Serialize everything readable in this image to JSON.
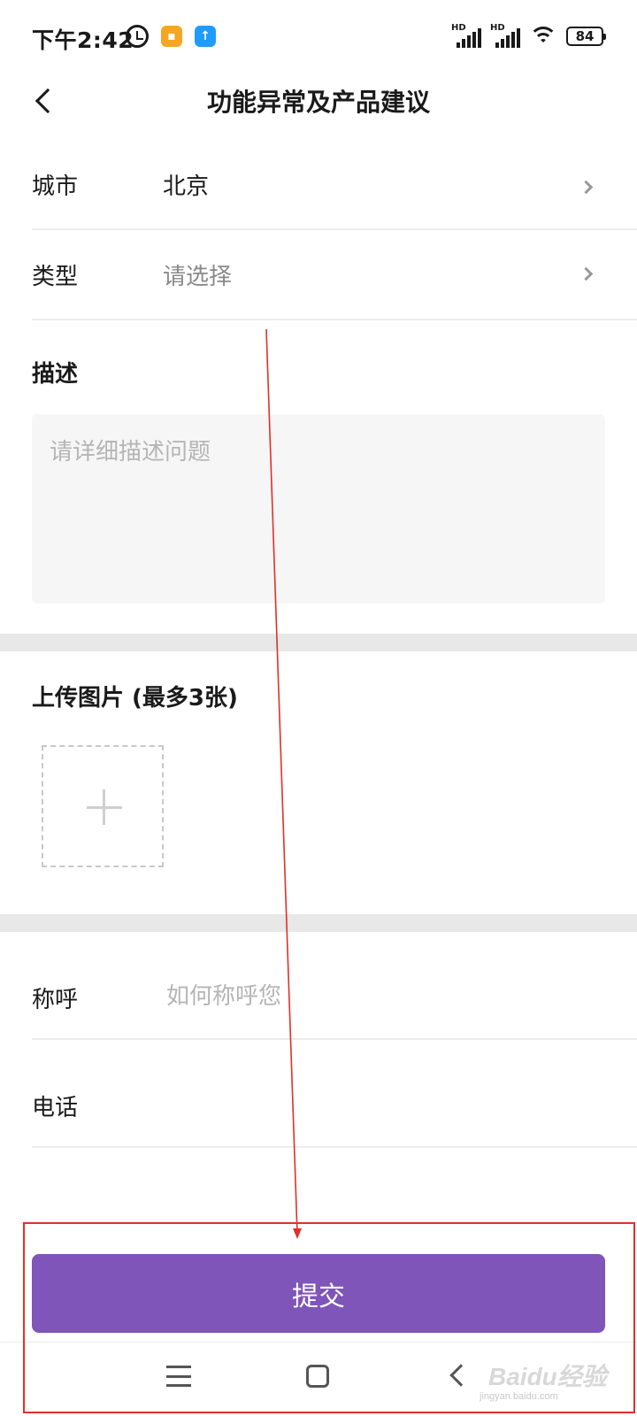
{
  "status_bar": {
    "time": "下午2:42",
    "left_icons": [
      "alarm-clock-icon",
      "notes-app-icon",
      "upload-app-icon"
    ],
    "network_label": "HD",
    "battery": "84"
  },
  "header": {
    "title": "功能异常及产品建议",
    "back_icon": "chevron-left-icon"
  },
  "form": {
    "city": {
      "label": "城市",
      "value": "北京"
    },
    "type": {
      "label": "类型",
      "value": "请选择"
    },
    "description": {
      "label": "描述",
      "placeholder": "请详细描述问题"
    },
    "upload": {
      "label": "上传图片 (最多3张)",
      "icon": "plus-icon"
    },
    "name": {
      "label": "称呼",
      "placeholder": "如何称呼您"
    },
    "phone": {
      "label": "电话",
      "placeholder": ""
    }
  },
  "submit": {
    "label": "提交",
    "color": "#7f55b9"
  },
  "annotation": {
    "color": "#e0302a"
  },
  "nav_bar": {
    "icons": [
      "menu-icon",
      "home-icon",
      "back-icon"
    ]
  },
  "watermark": {
    "main": "Baidu经验",
    "sub": "jingyan.baidu.com"
  }
}
